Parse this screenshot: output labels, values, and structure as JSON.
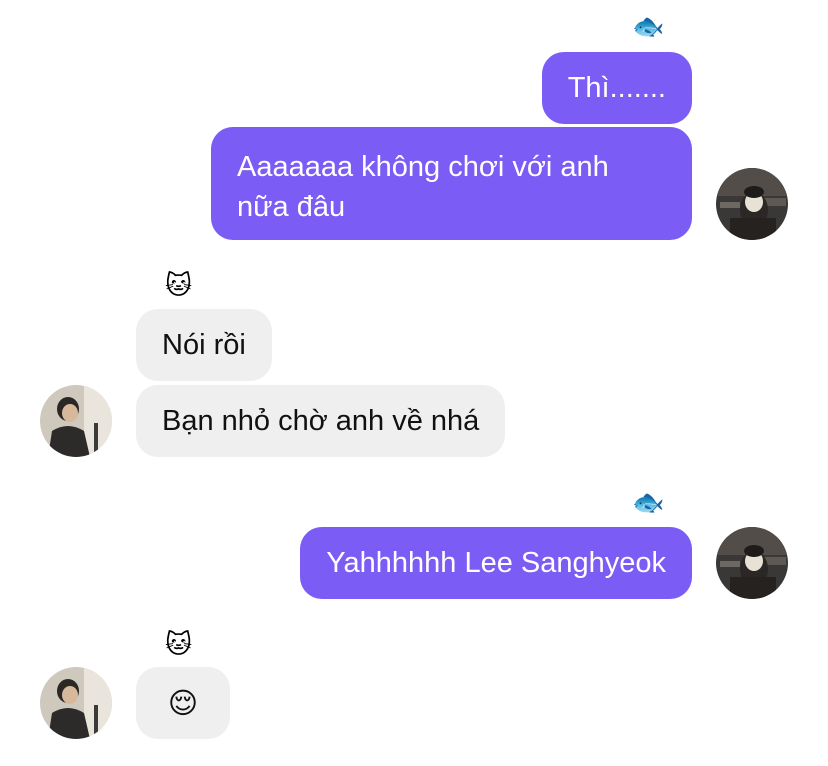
{
  "messages": [
    {
      "text": "Thì.......",
      "direction": "outgoing"
    },
    {
      "text": "Aaaaaaa không chơi với anh nữa đâu",
      "direction": "outgoing"
    },
    {
      "text": "Nói rồi",
      "direction": "incoming"
    },
    {
      "text": "Bạn nhỏ chờ anh về nhá",
      "direction": "incoming"
    },
    {
      "text": "Yahhhhhh Lee Sanghyeok",
      "direction": "outgoing"
    },
    {
      "text": "😌",
      "direction": "incoming"
    }
  ],
  "reactions": {
    "outgoing_group_1": "🐟",
    "incoming_group_1": "🐱",
    "outgoing_group_2": "🐟",
    "incoming_group_2": "🐱"
  },
  "colors": {
    "outgoing_bubble": "#7B5CF5",
    "incoming_bubble": "#EFEFEF",
    "outgoing_text": "#FFFFFF",
    "incoming_text": "#111111"
  },
  "icons": {
    "outgoing_avatar": "user-avatar-photo",
    "incoming_avatar": "contact-avatar-photo"
  }
}
